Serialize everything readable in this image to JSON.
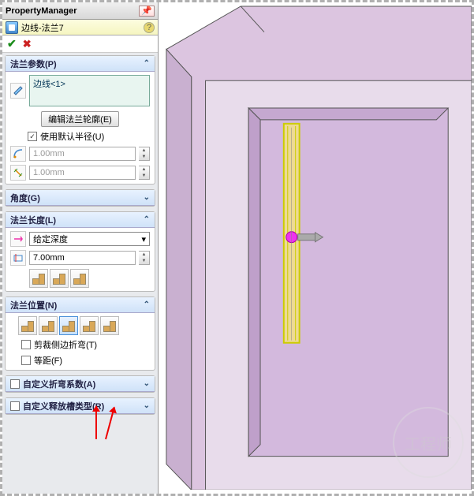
{
  "header": {
    "title": "PropertyManager"
  },
  "feature": {
    "name": "边线-法兰7"
  },
  "flange_params": {
    "title": "法兰参数(P)",
    "edge_selection": "边线<1>",
    "edit_profile_btn": "编辑法兰轮廓(E)",
    "use_default_radius_label": "使用默认半径(U)",
    "use_default_radius_checked": true,
    "radius_value": "1.00mm",
    "gap_value": "1.00mm"
  },
  "angle": {
    "title": "角度(G)"
  },
  "flange_length": {
    "title": "法兰长度(L)",
    "type_label": "给定深度",
    "depth_value": "7.00mm"
  },
  "flange_position": {
    "title": "法兰位置(N)",
    "trim_side_bends_label": "剪裁侧边折弯(T)",
    "trim_side_bends_checked": false,
    "offset_label": "等距(F)",
    "offset_checked": false
  },
  "custom_bend": {
    "title": "自定义折弯系数(A)",
    "checked": false
  },
  "custom_relief": {
    "title": "自定义释放槽类型(R)",
    "checked": false
  }
}
